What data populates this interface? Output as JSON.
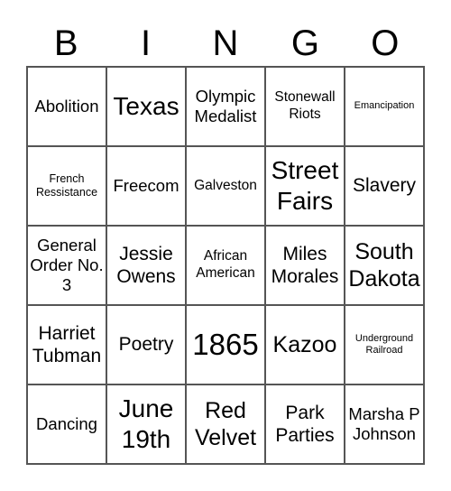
{
  "header": {
    "letters": [
      "B",
      "I",
      "N",
      "G",
      "O"
    ]
  },
  "board": {
    "rows": [
      [
        "Abolition",
        "Texas",
        "Olympic Medalist",
        "Stonewall Riots",
        "Emancipation"
      ],
      [
        "French Ressistance",
        "Freecom",
        "Galveston",
        "Street Fairs",
        "Slavery"
      ],
      [
        "General Order No. 3",
        "Jessie Owens",
        "African American",
        "Miles Morales",
        "South Dakota"
      ],
      [
        "Harriet Tubman",
        "Poetry",
        "1865",
        "Kazoo",
        "Underground Railroad"
      ],
      [
        "Dancing",
        "June 19th",
        "Red Velvet",
        "Park Parties",
        "Marsha P Johnson"
      ]
    ]
  }
}
